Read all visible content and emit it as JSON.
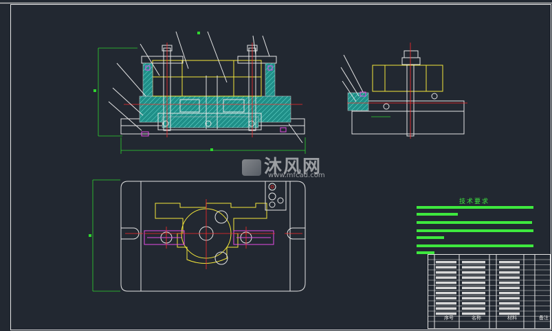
{
  "watermark": {
    "text": "沐风网",
    "url": "www.mfcad.com",
    "logo": "mf-logo-icon"
  },
  "tech_requirements": {
    "title": "技术要求"
  },
  "title_block": {
    "headers": [
      "序号",
      "名称",
      "材料",
      "备注"
    ]
  },
  "colors": {
    "background": "#222831",
    "outline": "#e6e6e6",
    "part_yellow": "#f5e83a",
    "dimension_green": "#2fd62f",
    "centerline_red": "#ff2a2a",
    "clamp_magenta": "#e64de6",
    "section_cyan": "#2aa7a0"
  }
}
